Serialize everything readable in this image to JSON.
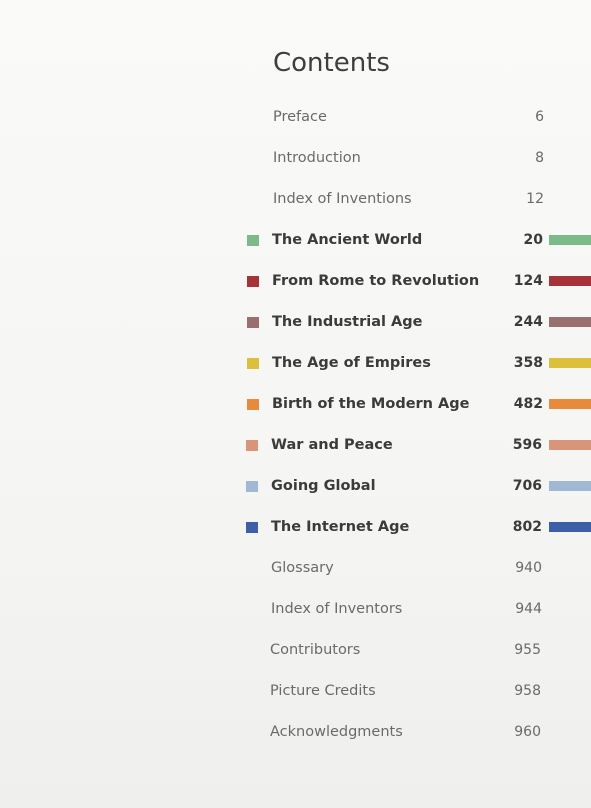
{
  "title": "Contents",
  "front_matter": [
    {
      "label": "Preface",
      "page": "6"
    },
    {
      "label": "Introduction",
      "page": "8"
    },
    {
      "label": "Index of Inventions",
      "page": "12"
    }
  ],
  "chapters": [
    {
      "label": "The Ancient World",
      "page": "20",
      "color": "#7dba8a"
    },
    {
      "label": "From Rome to Revolution",
      "page": "124",
      "color": "#a8323a"
    },
    {
      "label": "The Industrial Age",
      "page": "244",
      "color": "#9a6f6f"
    },
    {
      "label": "The Age of Empires",
      "page": "358",
      "color": "#dcc03c"
    },
    {
      "label": "Birth of the Modern Age",
      "page": "482",
      "color": "#e88a3c"
    },
    {
      "label": "War and Peace",
      "page": "596",
      "color": "#d9957a"
    },
    {
      "label": "Going Global",
      "page": "706",
      "color": "#9fb8d4"
    },
    {
      "label": "The Internet Age",
      "page": "802",
      "color": "#3c5fa8"
    }
  ],
  "back_matter": [
    {
      "label": "Glossary",
      "page": "940"
    },
    {
      "label": "Index of Inventors",
      "page": "944"
    },
    {
      "label": "Contributors",
      "page": "955"
    },
    {
      "label": "Picture Credits",
      "page": "958"
    },
    {
      "label": "Acknowledgments",
      "page": "960"
    }
  ]
}
